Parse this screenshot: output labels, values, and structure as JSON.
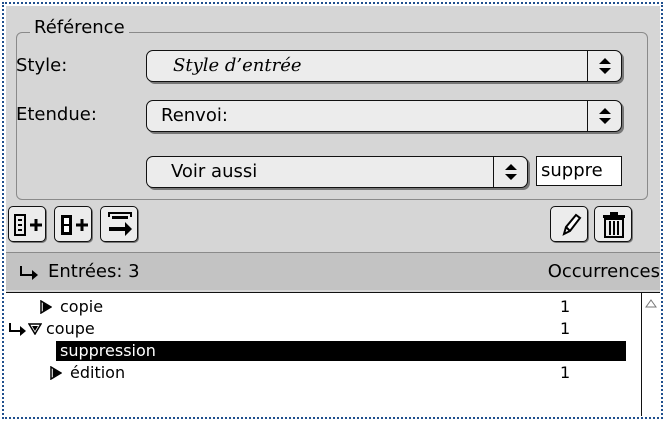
{
  "group": {
    "title": "Référence"
  },
  "style": {
    "label": "Style:",
    "value": "Style d’entrée"
  },
  "extent": {
    "label": "Etendue:",
    "value": "Renvoi:"
  },
  "see_also": {
    "value": "Voir aussi",
    "field_value": "suppre"
  },
  "toolbar": {
    "buttons": [
      "add-entry-icon",
      "add-subentry-icon",
      "move-entry-icon",
      "edit-pencil-icon",
      "trash-icon"
    ]
  },
  "header": {
    "entries": "Entrées: 3",
    "occurrences": "Occurrences"
  },
  "list": {
    "rows": [
      {
        "label": "copie",
        "count": "1",
        "expanded": false
      },
      {
        "label": "coupe",
        "count": "1",
        "expanded": true
      },
      {
        "label": "suppression",
        "count": "",
        "selected": true
      },
      {
        "label": "édition",
        "count": "1",
        "expanded": false
      }
    ]
  },
  "colors": {
    "panel": "#d6d6d6",
    "header": "#c3c3c3",
    "frame": "#1f4f8e",
    "selection": "#000000"
  }
}
